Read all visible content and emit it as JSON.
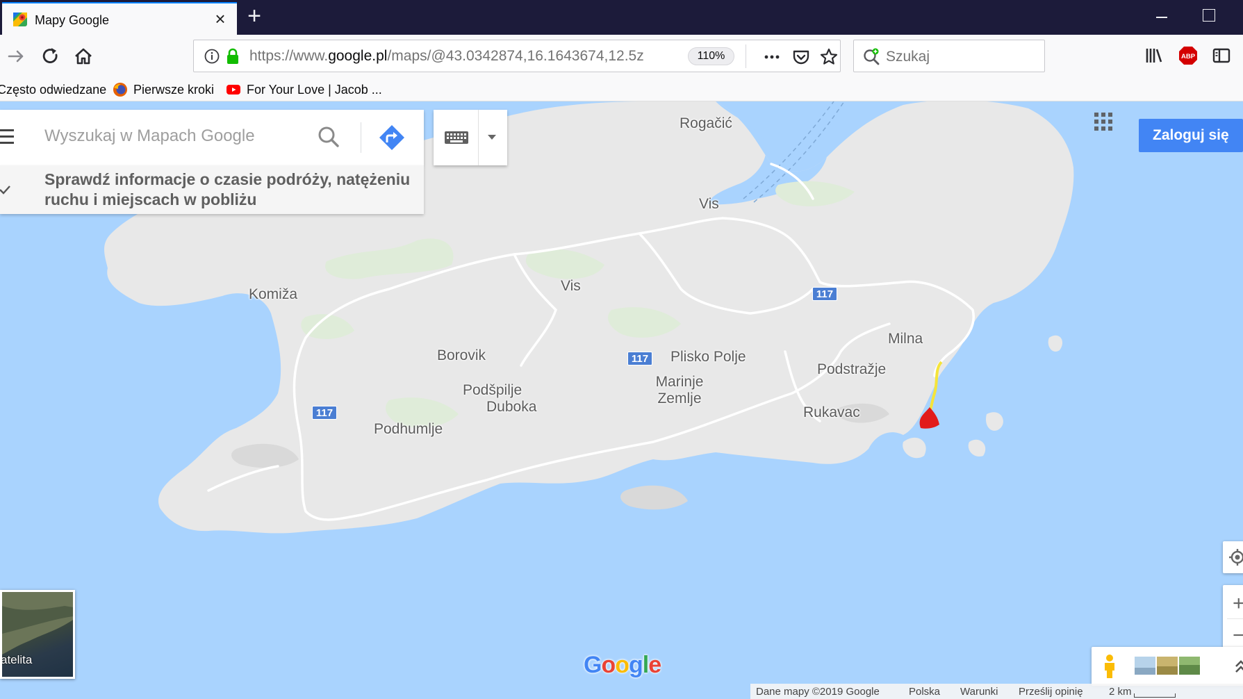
{
  "browser": {
    "tab": {
      "title": "Mapy Google"
    },
    "url": {
      "prefix": "https://www.",
      "host": "google.pl",
      "path": "/maps/@43.0342874,16.1643674,12.5z"
    },
    "zoom": "110%",
    "search_placeholder": "Szukaj",
    "bookmarks": [
      {
        "label": "Często odwiedzane"
      },
      {
        "label": "Pierwsze kroki"
      },
      {
        "label": "For Your Love | Jacob ..."
      }
    ]
  },
  "map": {
    "search": {
      "placeholder": "Wyszukaj w Mapach Google"
    },
    "info": "Sprawdź informacje o czasie podróży, natężeniu ruchu i miejscach w pobliżu",
    "signin": "Zaloguj się",
    "satellite_label": "atelita",
    "places": [
      {
        "name": "Rogačić"
      },
      {
        "name": "Vis"
      },
      {
        "name": "Vis"
      },
      {
        "name": "Komiža"
      },
      {
        "name": "Milna"
      },
      {
        "name": "Borovik"
      },
      {
        "name": "Plisko Polje"
      },
      {
        "name": "Podstražje"
      },
      {
        "name": "Marinje Zemlje"
      },
      {
        "name": "Podšpilje"
      },
      {
        "name": "Duboka"
      },
      {
        "name": "Rukavac"
      },
      {
        "name": "Podhumlje"
      }
    ],
    "road_shields": [
      "117",
      "117",
      "117"
    ],
    "logo": {
      "g1": "G",
      "o1": "o",
      "o2": "o",
      "g2": "g",
      "l": "l",
      "e": "e"
    },
    "footer": {
      "data": "Dane mapy ©2019 Google",
      "country": "Polska",
      "terms": "Warunki",
      "feedback": "Prześlij opinię",
      "scale": "2 km"
    }
  },
  "colors": {
    "water": "#a9d3fe",
    "land": "#e8e8e8",
    "accent": "#4285f4",
    "route_red": "#e21b1b",
    "route_yellow": "#f5e43a"
  }
}
